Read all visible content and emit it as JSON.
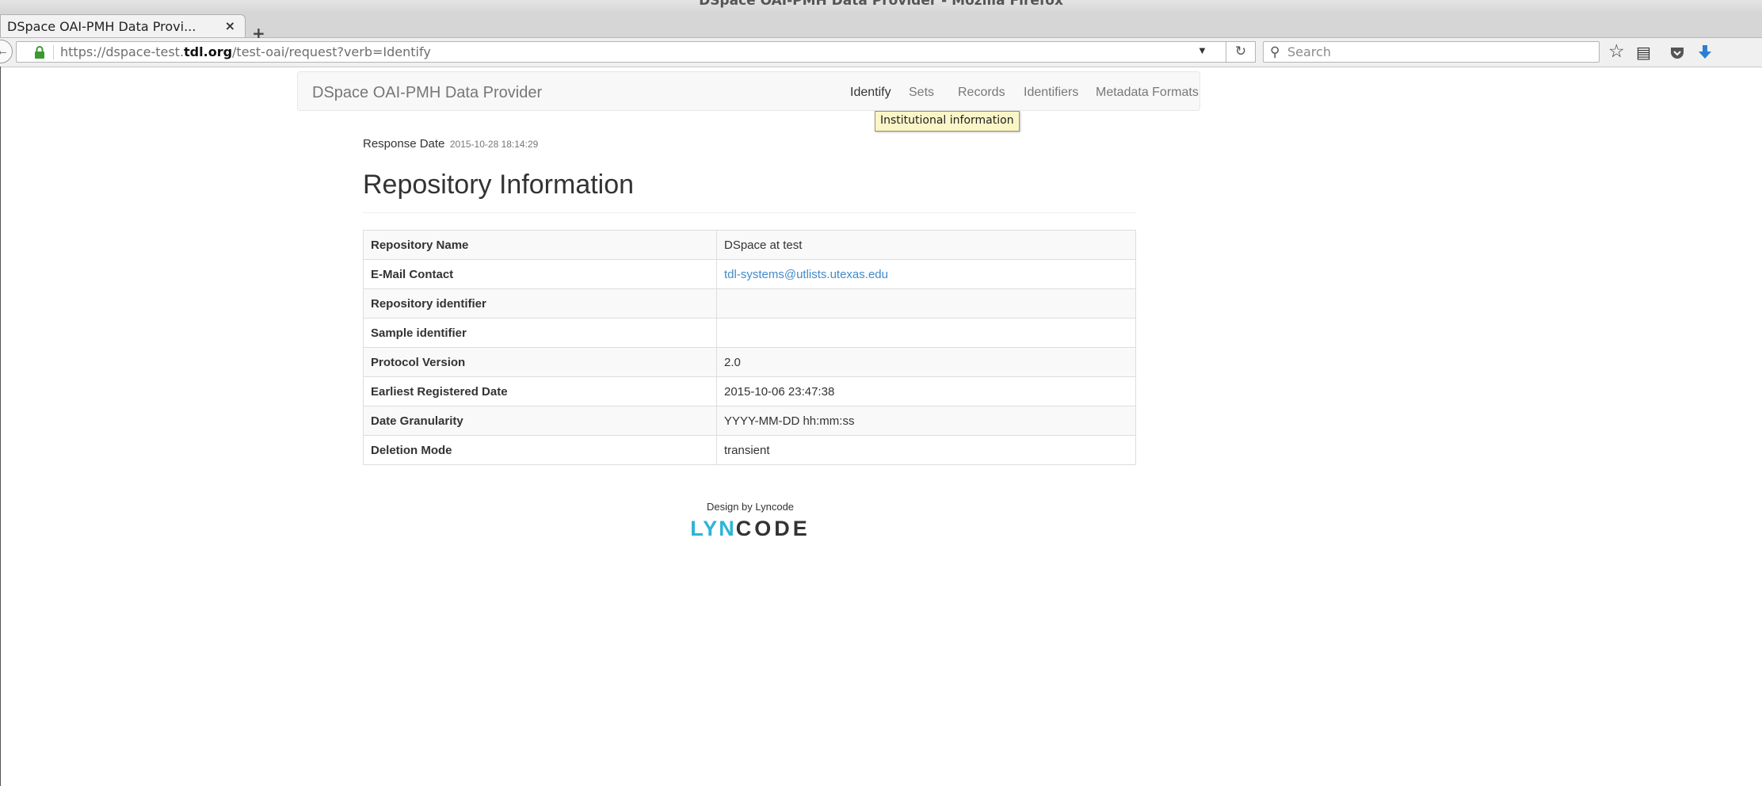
{
  "window": {
    "title": "DSpace OAI-PMH Data Provider - Mozilla Firefox"
  },
  "browser": {
    "tab_label": "DSpace OAI-PMH Data Provi...",
    "tab_close": "×",
    "new_tab": "+",
    "url_prefix": "https://dspace-test.",
    "url_domain": "tdl.org",
    "url_path": "/test-oai/request?verb=Identify",
    "search_placeholder": "Search",
    "icons": [
      "back-arrow-icon",
      "lock-icon",
      "dropdown-icon",
      "reload-icon",
      "search-icon",
      "bookmark-star-icon",
      "reading-list-icon",
      "pocket-icon",
      "download-icon"
    ]
  },
  "site": {
    "brand": "DSpace OAI-PMH Data Provider",
    "nav": [
      {
        "label": "Identify",
        "active": true
      },
      {
        "label": "Sets"
      },
      {
        "label": "Records"
      },
      {
        "label": "Identifiers"
      },
      {
        "label": "Metadata Formats"
      }
    ],
    "tooltip": "Institutional information"
  },
  "main": {
    "response_label": "Response Date",
    "response_date": "2015-10-28 18:14:29",
    "heading": "Repository Information",
    "rows": [
      {
        "key": "Repository Name",
        "value": "DSpace at test"
      },
      {
        "key": "E-Mail Contact",
        "value": "tdl-systems@utlists.utexas.edu",
        "link": true
      },
      {
        "key": "Repository identifier",
        "value": ""
      },
      {
        "key": "Sample identifier",
        "value": ""
      },
      {
        "key": "Protocol Version",
        "value": "2.0"
      },
      {
        "key": "Earliest Registered Date",
        "value": "2015-10-06 23:47:38"
      },
      {
        "key": "Date Granularity",
        "value": "YYYY-MM-DD hh:mm:ss"
      },
      {
        "key": "Deletion Mode",
        "value": "transient"
      }
    ]
  },
  "footer": {
    "design_by": "Design by Lyncode",
    "logo_left": "LYN",
    "logo_right": "CODE"
  },
  "colors": {
    "link": "#428bca",
    "tooltip_bg": "#fbf6c8",
    "logo_accent": "#2db4d6"
  }
}
